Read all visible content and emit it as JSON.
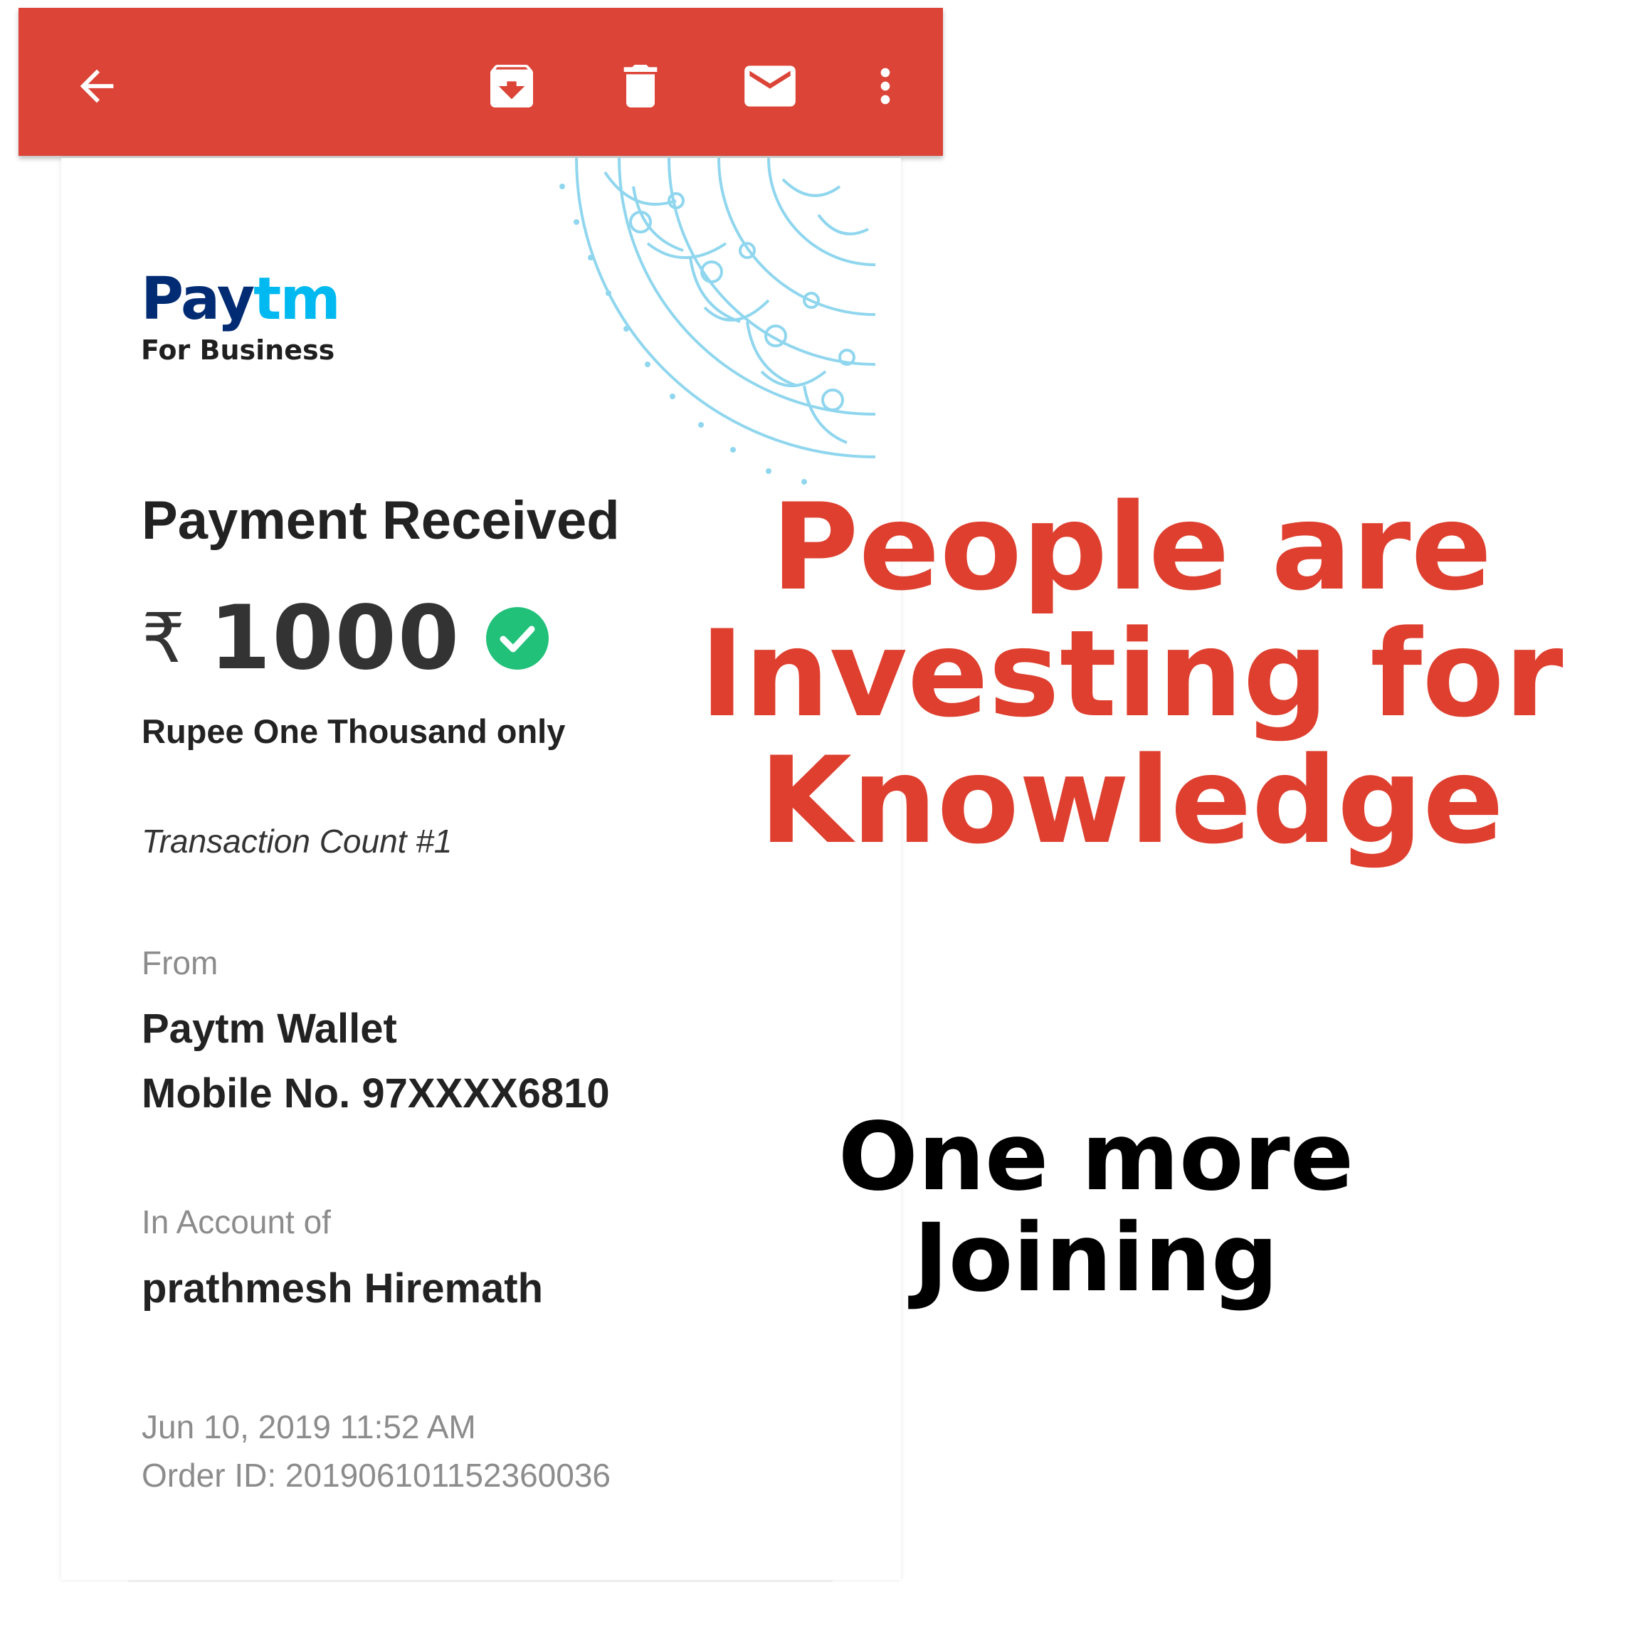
{
  "toolbar": {
    "background": "#db4437",
    "icons": [
      "back-arrow-icon",
      "archive-icon",
      "delete-icon",
      "mark-unread-icon",
      "more-vert-icon"
    ]
  },
  "logo": {
    "brand_a": "Pay",
    "brand_b": "tm",
    "sub": "For Business",
    "colors": {
      "dark": "#012b72",
      "light": "#00b9f1"
    }
  },
  "receipt": {
    "title": "Payment Received",
    "currency_symbol": "₹",
    "amount": "1000",
    "amount_words": "Rupee One Thousand only",
    "transaction_count": "Transaction Count #1",
    "from_label": "From",
    "from_name": "Paytm Wallet",
    "from_mobile": "Mobile No. 97XXXX6810",
    "account_label": "In Account of",
    "account_name": "prathmesh Hiremath",
    "datetime": "Jun 10, 2019 11:52 AM",
    "order_id": "Order ID: 201906101152360036"
  },
  "overlay": {
    "headline_line1": "People are",
    "headline_line2": "Investing for",
    "headline_line3": "Knowledge",
    "subline_line1": "One more",
    "subline_line2": "Joining",
    "headline_color": "#de3f2f",
    "subline_color": "#000000"
  }
}
